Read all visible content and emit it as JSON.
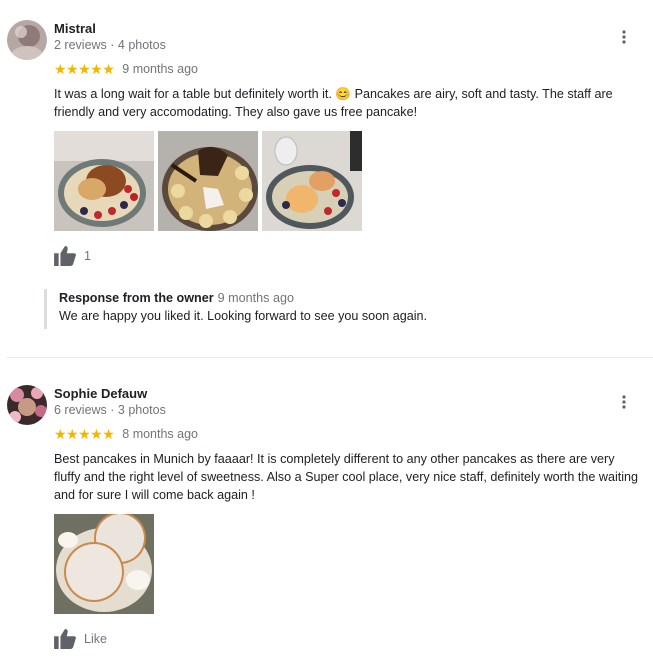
{
  "reviews": [
    {
      "name": "Mistral",
      "meta": "2 reviews · 4 photos",
      "stars": "★★★★★",
      "rating": 5,
      "time": "9 months ago",
      "text": "It was a long wait for a table but definitely worth it. 😊 Pancakes are airy, soft and tasty. The staff are friendly and very accomodating. They also gave us free pancake!",
      "like_count": "1",
      "owner_response": {
        "title": "Response from the owner",
        "time": "9 months ago",
        "text": "We are happy you liked it. Looking forward to see you soon again."
      }
    },
    {
      "name": "Sophie Defauw",
      "meta": "6 reviews · 3 photos",
      "stars": "★★★★★",
      "rating": 5,
      "time": "8 months ago",
      "text": "Best pancakes in Munich by faaaar! It is completely different to any other pancakes as there are very fluffy and the right level of sweetness. Also a Super cool place, very nice staff, definitely worth the waiting and for sure I will come back again !",
      "like_label": "Like"
    }
  ],
  "colors": {
    "star": "#f5b400",
    "secondary_text": "#70757a",
    "divider": "#e8eaed"
  },
  "icons": {
    "more": "more-vert-icon",
    "like": "thumb-up-icon"
  }
}
